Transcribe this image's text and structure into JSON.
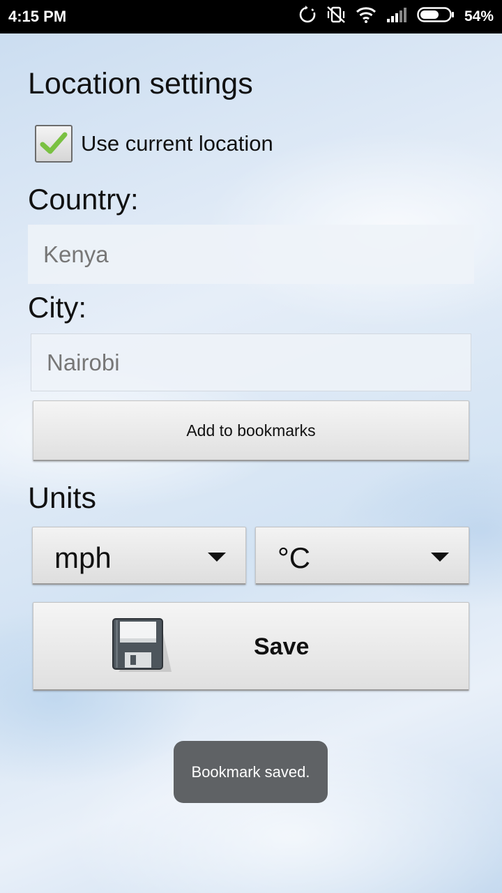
{
  "status_bar": {
    "time": "4:15 PM",
    "battery_percent": "54%",
    "icons": [
      "sync-icon",
      "vibrate-icon",
      "wifi-icon",
      "signal-icon",
      "battery-icon"
    ]
  },
  "location": {
    "title": "Location settings",
    "use_current_label": "Use current location",
    "use_current_checked": true,
    "country_label": "Country:",
    "country_value": "Kenya",
    "city_label": "City:",
    "city_value": "Nairobi",
    "add_bookmark_label": "Add to bookmarks"
  },
  "units": {
    "title": "Units",
    "speed_selected": "mph",
    "temperature_selected": "°C"
  },
  "save": {
    "label": "Save",
    "icon": "floppy-disk-icon"
  },
  "toast": {
    "message": "Bookmark saved."
  },
  "colors": {
    "check": "#7ac142",
    "toast_bg": "#5f6265"
  }
}
